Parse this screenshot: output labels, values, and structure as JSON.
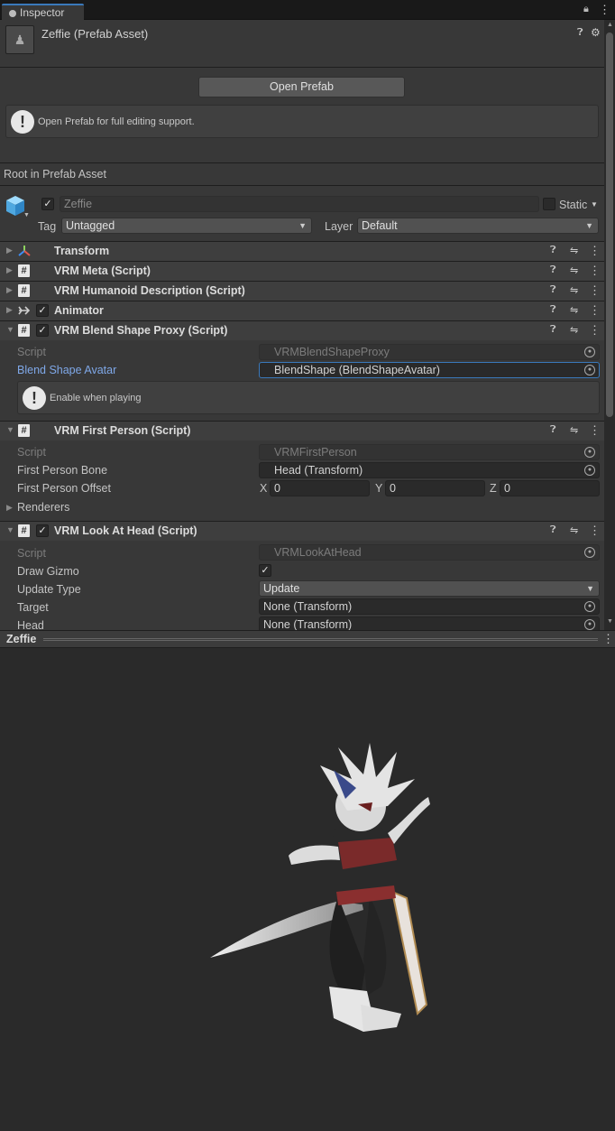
{
  "tab": {
    "title": "Inspector"
  },
  "header": {
    "title": "Zeffie (Prefab Asset)",
    "open_prefab": "Open Prefab",
    "help_text": "Open Prefab for full editing support."
  },
  "root_label": "Root in Prefab Asset",
  "gameobject": {
    "name": "Zeffie",
    "static_label": "Static",
    "tag_label": "Tag",
    "tag_value": "Untagged",
    "layer_label": "Layer",
    "layer_value": "Default"
  },
  "components": {
    "transform": "Transform",
    "vrm_meta": "VRM Meta (Script)",
    "humanoid": "VRM Humanoid Description (Script)",
    "animator": "Animator",
    "blendshape": {
      "title": "VRM Blend Shape Proxy (Script)",
      "script_label": "Script",
      "script_value": "VRMBlendShapeProxy",
      "avatar_label": "Blend Shape Avatar",
      "avatar_value": "BlendShape (BlendShapeAvatar)",
      "help": "Enable when playing"
    },
    "first_person": {
      "title": "VRM First Person (Script)",
      "script_label": "Script",
      "script_value": "VRMFirstPerson",
      "bone_label": "First Person Bone",
      "bone_value": "Head (Transform)",
      "offset_label": "First Person Offset",
      "x_label": "X",
      "x": "0",
      "y_label": "Y",
      "y": "0",
      "z_label": "Z",
      "z": "0",
      "renderers": "Renderers"
    },
    "look_at": {
      "title": "VRM Look At Head (Script)",
      "script_label": "Script",
      "script_value": "VRMLookAtHead",
      "gizmo_label": "Draw Gizmo",
      "update_label": "Update Type",
      "update_value": "Update",
      "target_label": "Target",
      "target_value": "None (Transform)",
      "head_label": "Head",
      "head_value": "None (Transform)"
    }
  },
  "preview": {
    "title": "Zeffie"
  },
  "colors": {
    "accent": "#3a79bb",
    "link": "#7fa8e8",
    "panel": "#383838",
    "scene": "#2a2a2a"
  },
  "icons": [
    "lock-icon",
    "kebab-icon",
    "help-icon",
    "settings-icon",
    "presets-icon",
    "script-icon",
    "transform-icon",
    "animator-icon",
    "gameobject-icon",
    "object-picker-icon"
  ]
}
